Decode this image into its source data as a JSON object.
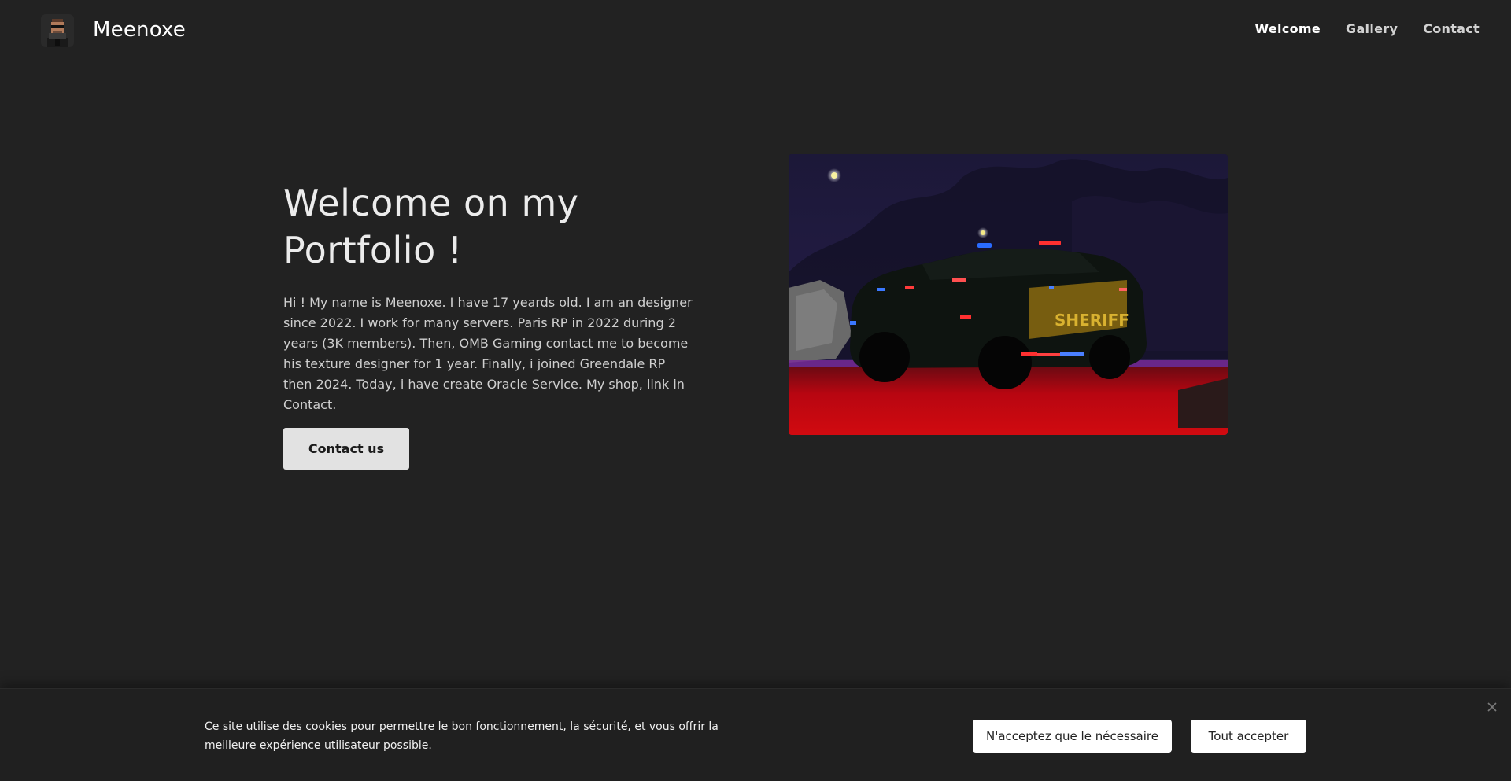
{
  "header": {
    "site_title": "Meenoxe",
    "avatar_icon": "avatar-icon",
    "nav": [
      {
        "label": "Welcome",
        "active": true
      },
      {
        "label": "Gallery",
        "active": false
      },
      {
        "label": "Contact",
        "active": false
      }
    ]
  },
  "hero": {
    "title": "Welcome on my Portfolio !",
    "text": "Hi ! My name is Meenoxe. I have 17 yeards old. I am an designer since 2022. I work for many servers. Paris RP in 2022 during 2 years (3K members). Then, OMB Gaming contact me to become his texture designer for 1 year. Finally, i joined Greendale RP then 2024. Today, i have create Oracle Service. My shop, link in Contact.",
    "cta_label": "Contact us",
    "image_decal": "SHERIFF"
  },
  "cookie_banner": {
    "text": "Ce site utilise des cookies pour permettre le bon fonctionnement, la sécurité, et vous offrir la meilleure expérience utilisateur possible.",
    "necessary_label": "N'acceptez que le nécessaire",
    "accept_label": "Tout accepter",
    "close_icon": "close-icon"
  },
  "colors": {
    "background": "#222222",
    "button_bg": "#e2e2e2",
    "cookie_bg": "#202020"
  }
}
